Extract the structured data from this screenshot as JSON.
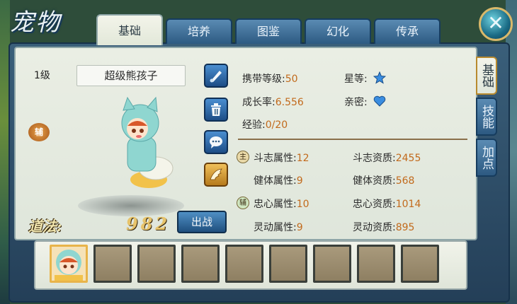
{
  "title": "宠物",
  "tabs": [
    {
      "label": "基础",
      "active": true
    },
    {
      "label": "培养",
      "active": false
    },
    {
      "label": "图鉴",
      "active": false
    },
    {
      "label": "幻化",
      "active": false
    },
    {
      "label": "传承",
      "active": false
    }
  ],
  "side_tabs": [
    {
      "label": "基础",
      "active": true
    },
    {
      "label": "技能",
      "active": false
    },
    {
      "label": "加点",
      "active": false
    }
  ],
  "pet": {
    "level": "1级",
    "name": "超级熊孩子",
    "rank_badge": "辅",
    "score_label": "道法:",
    "score_value": "982",
    "deploy_label": "出战"
  },
  "tools": [
    "brush-icon",
    "trash-icon",
    "chat-icon",
    "wing-icon"
  ],
  "info": {
    "carry_level_label": "携带等级:",
    "carry_level_value": "50",
    "star_label": "星等:",
    "growth_label": "成长率:",
    "growth_value": "6.556",
    "intimacy_label": "亲密:",
    "exp_label": "经验:",
    "exp_value": "0/20"
  },
  "attributes": [
    {
      "badge": "主",
      "attr_label": "斗志属性:",
      "attr_value": "12",
      "apt_label": "斗志资质:",
      "apt_value": "2455"
    },
    {
      "badge": "",
      "attr_label": "健体属性:",
      "attr_value": "9",
      "apt_label": "健体资质:",
      "apt_value": "568"
    },
    {
      "badge": "辅",
      "attr_label": "忠心属性:",
      "attr_value": "10",
      "apt_label": "忠心资质:",
      "apt_value": "1014"
    },
    {
      "badge": "",
      "attr_label": "灵动属性:",
      "attr_value": "9",
      "apt_label": "灵动资质:",
      "apt_value": "895"
    }
  ],
  "colors": {
    "accent_blue": "#2d5a82",
    "value_orange": "#c26a1c",
    "gold": "#e8b44a"
  }
}
